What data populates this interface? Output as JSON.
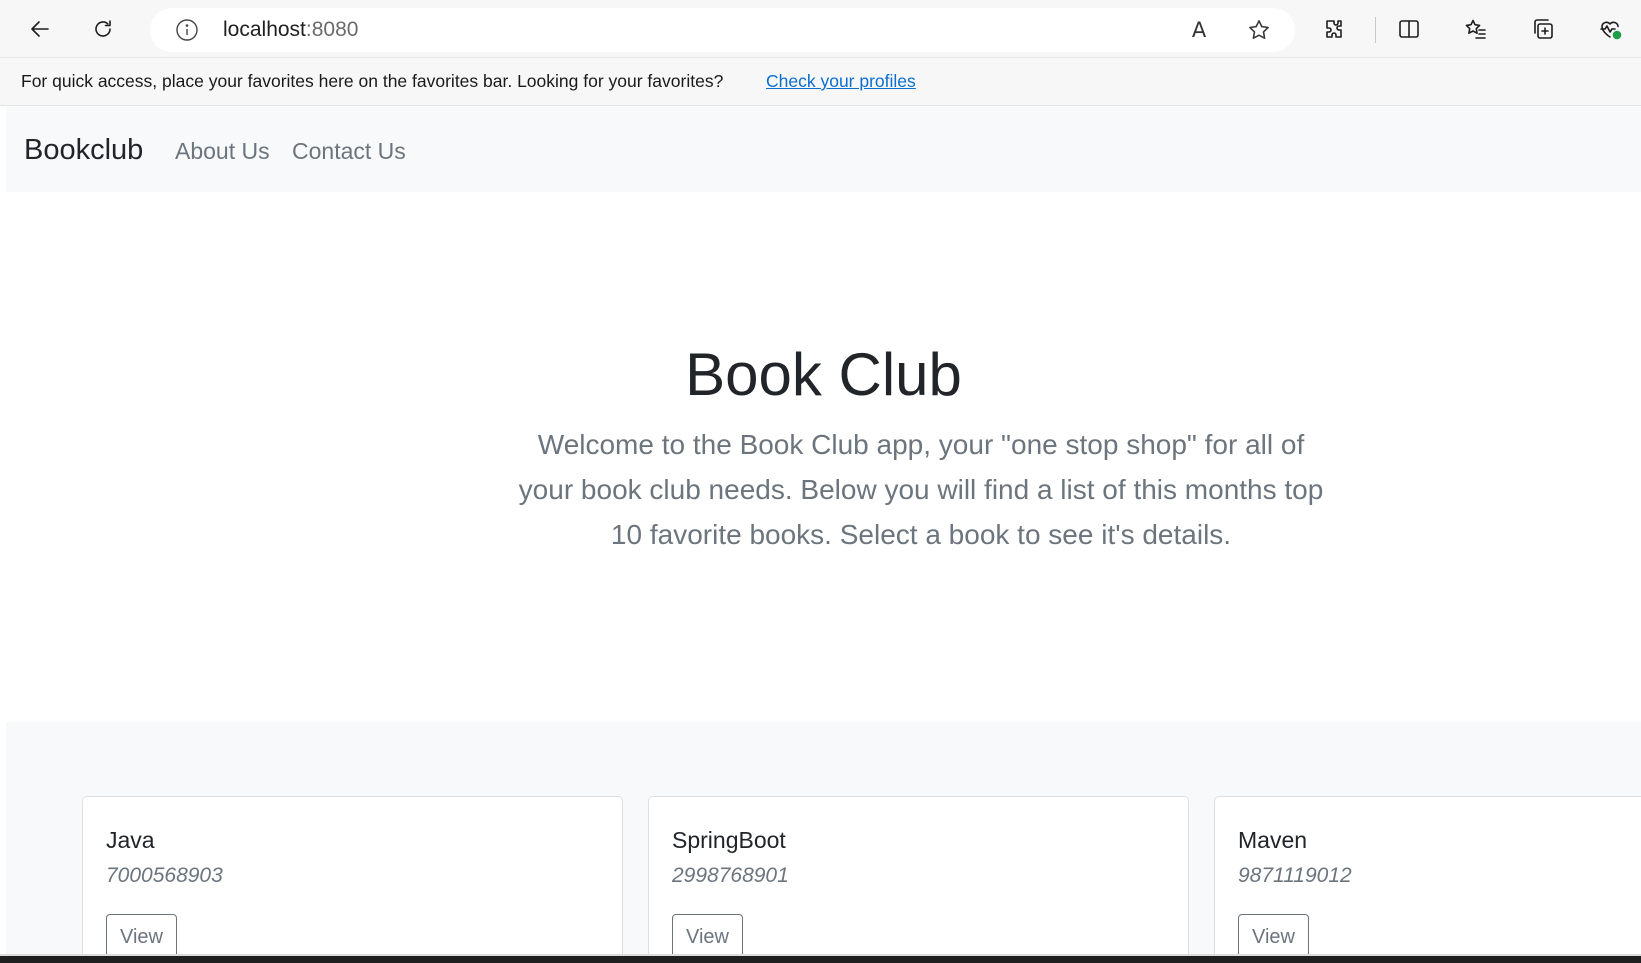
{
  "browser": {
    "url_host": "localhost",
    "url_port": ":8080",
    "read_aloud_glyph": "A",
    "icons": [
      "back-icon",
      "refresh-icon",
      "site-info-icon",
      "read-aloud-icon",
      "favorite-star-icon",
      "extensions-icon",
      "split-screen-icon",
      "favorites-icon",
      "collections-icon",
      "browser-essentials-icon"
    ]
  },
  "favbar": {
    "message": "For quick access, place your favorites here on the favorites bar. Looking for your favorites?",
    "link": "Check your profiles"
  },
  "navbar": {
    "brand": "Bookclub",
    "links": [
      "About Us",
      "Contact Us"
    ]
  },
  "hero": {
    "title": "Book Club",
    "lead": "Welcome to the Book Club app, your \"one stop shop\" for all of your book club needs. Below you will find a list of this months top 10 favorite books. Select a book to see it's details."
  },
  "books": [
    {
      "title": "Java",
      "isbn": "7000568903",
      "button": "View"
    },
    {
      "title": "SpringBoot",
      "isbn": "2998768901",
      "button": "View"
    },
    {
      "title": "Maven",
      "isbn": "9871119012",
      "button": "View"
    }
  ],
  "colors": {
    "link": "#0a6ed1",
    "muted": "#6c757d",
    "navbar_bg": "#f8f9fa"
  }
}
